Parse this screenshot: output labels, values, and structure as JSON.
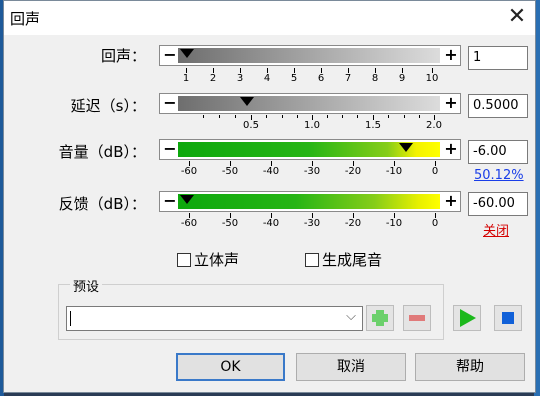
{
  "window": {
    "title": "回声",
    "close_glyph": "✕"
  },
  "sliders": {
    "repeats": {
      "label": "回声：",
      "value": "1",
      "ticks": [
        "1",
        "2",
        "3",
        "4",
        "5",
        "6",
        "7",
        "8",
        "9",
        "10"
      ]
    },
    "delay": {
      "label": "延迟（s）：",
      "value": "0.5000",
      "ticks": [
        "0.5",
        "1.0",
        "1.5",
        "2.0"
      ]
    },
    "volume": {
      "label": "音量（dB）：",
      "value": "-6.00",
      "percent_link": "50.12%",
      "ticks": [
        "-60",
        "-50",
        "-40",
        "-30",
        "-20",
        "-10",
        "0"
      ]
    },
    "feedback": {
      "label": "反馈（dB）：",
      "value": "-60.00",
      "off_link": "关闭",
      "ticks": [
        "-60",
        "-50",
        "-40",
        "-30",
        "-20",
        "-10",
        "0"
      ]
    }
  },
  "slider_symbols": {
    "minus": "−",
    "plus": "+"
  },
  "options": {
    "stereo": "立体声",
    "tail": "生成尾音"
  },
  "presets": {
    "group_label": "预设",
    "value": "",
    "chevron": "⌵"
  },
  "buttons": {
    "ok": "OK",
    "cancel": "取消",
    "help": "帮助"
  },
  "colors": {
    "link_blue": "#1a3ee8",
    "link_red": "#d40000",
    "play_green": "#1bb81b",
    "stop_blue": "#1060d8",
    "add_green": "#6bd06b",
    "remove_red": "#e07a7a"
  }
}
